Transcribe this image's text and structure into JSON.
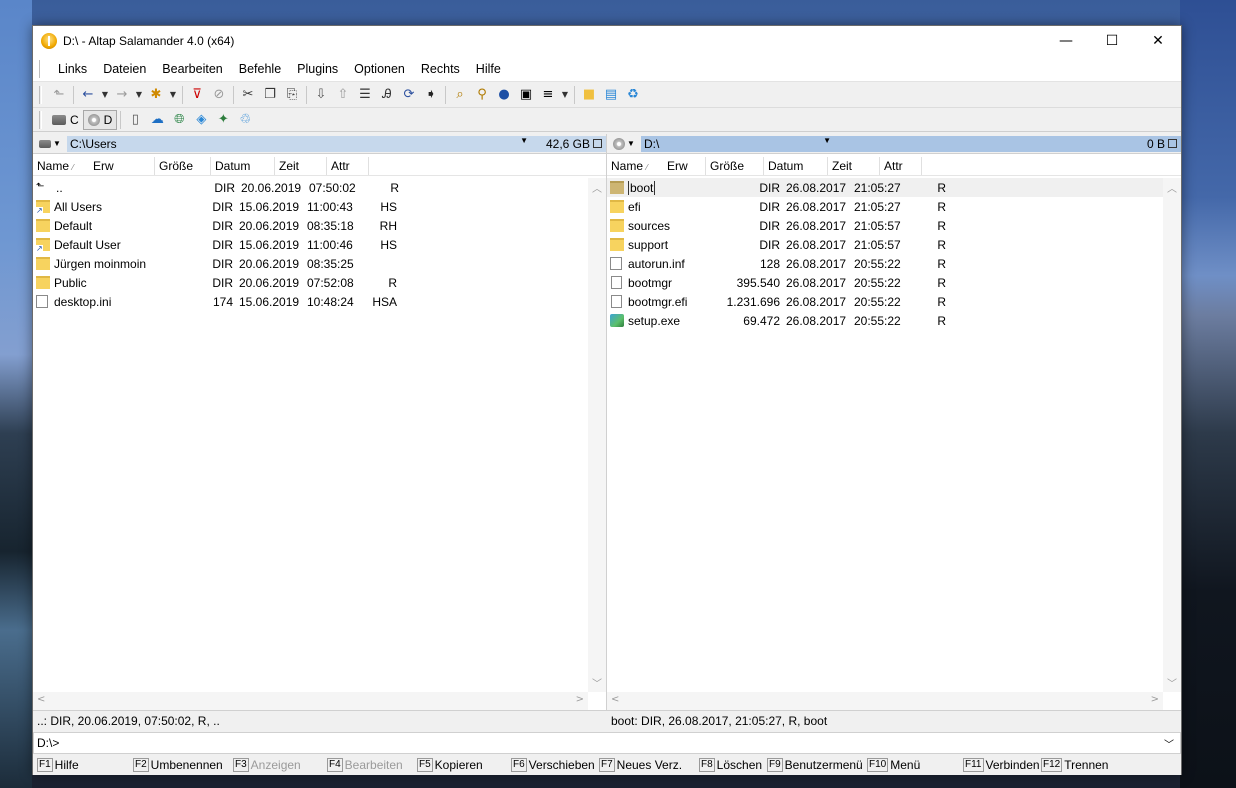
{
  "window": {
    "title": "D:\\ - Altap Salamander 4.0 (x64)"
  },
  "titlebar_buttons": {
    "minimize": "—",
    "maximize": "☐",
    "close": "✕"
  },
  "menu": [
    "Links",
    "Dateien",
    "Bearbeiten",
    "Befehle",
    "Plugins",
    "Optionen",
    "Rechts",
    "Hilfe"
  ],
  "drives": {
    "c": "C",
    "d": "D"
  },
  "left_panel": {
    "path": "C:\\Users",
    "free_space": "42,6 GB",
    "columns": [
      "Name",
      "Erw",
      "Größe",
      "Datum",
      "Zeit",
      "Attr"
    ],
    "rows": [
      {
        "name": "..",
        "size": "DIR",
        "date": "20.06.2019",
        "time": "07:50:02",
        "attr": "R",
        "icon": "up-dir-icon"
      },
      {
        "name": "All Users",
        "size": "DIR",
        "date": "15.06.2019",
        "time": "11:00:43",
        "attr": "HS",
        "icon": "folder-link-icon"
      },
      {
        "name": "Default",
        "size": "DIR",
        "date": "20.06.2019",
        "time": "08:35:18",
        "attr": "RH",
        "icon": "folder-icon"
      },
      {
        "name": "Default User",
        "size": "DIR",
        "date": "15.06.2019",
        "time": "11:00:46",
        "attr": "HS",
        "icon": "folder-link-icon"
      },
      {
        "name": "Jürgen moinmoin",
        "size": "DIR",
        "date": "20.06.2019",
        "time": "08:35:25",
        "attr": "",
        "icon": "folder-icon"
      },
      {
        "name": "Public",
        "size": "DIR",
        "date": "20.06.2019",
        "time": "07:52:08",
        "attr": "R",
        "icon": "folder-icon"
      },
      {
        "name": "desktop.ini",
        "size": "174",
        "date": "15.06.2019",
        "time": "10:48:24",
        "attr": "HSA",
        "icon": "settings-file-icon"
      }
    ],
    "status": "..: DIR, 20.06.2019, 07:50:02, R, .."
  },
  "right_panel": {
    "path": "D:\\",
    "free_space": "0 B",
    "columns": [
      "Name",
      "Erw",
      "Größe",
      "Datum",
      "Zeit",
      "Attr"
    ],
    "rows": [
      {
        "name": "boot",
        "size": "DIR",
        "date": "26.08.2017",
        "time": "21:05:27",
        "attr": "R",
        "icon": "folder-icon"
      },
      {
        "name": "efi",
        "size": "DIR",
        "date": "26.08.2017",
        "time": "21:05:27",
        "attr": "R",
        "icon": "folder-icon"
      },
      {
        "name": "sources",
        "size": "DIR",
        "date": "26.08.2017",
        "time": "21:05:57",
        "attr": "R",
        "icon": "folder-icon"
      },
      {
        "name": "support",
        "size": "DIR",
        "date": "26.08.2017",
        "time": "21:05:57",
        "attr": "R",
        "icon": "folder-icon"
      },
      {
        "name": "autorun.inf",
        "size": "128",
        "date": "26.08.2017",
        "time": "20:55:22",
        "attr": "R",
        "icon": "settings-file-icon"
      },
      {
        "name": "bootmgr",
        "size": "395.540",
        "date": "26.08.2017",
        "time": "20:55:22",
        "attr": "R",
        "icon": "file-icon"
      },
      {
        "name": "bootmgr.efi",
        "size": "1.231.696",
        "date": "26.08.2017",
        "time": "20:55:22",
        "attr": "R",
        "icon": "file-icon"
      },
      {
        "name": "setup.exe",
        "size": "69.472",
        "date": "26.08.2017",
        "time": "20:55:22",
        "attr": "R",
        "icon": "exe-icon"
      }
    ],
    "status": "boot: DIR, 26.08.2017, 21:05:27, R, boot"
  },
  "command_line": "D:\\>",
  "fkeys": [
    {
      "key": "F1",
      "label": "Hilfe",
      "enabled": true
    },
    {
      "key": "F2",
      "label": "Umbenennen",
      "enabled": true
    },
    {
      "key": "F3",
      "label": "Anzeigen",
      "enabled": false
    },
    {
      "key": "F4",
      "label": "Bearbeiten",
      "enabled": false
    },
    {
      "key": "F5",
      "label": "Kopieren",
      "enabled": true
    },
    {
      "key": "F6",
      "label": "Verschieben",
      "enabled": true
    },
    {
      "key": "F7",
      "label": "Neues Verz.",
      "enabled": true
    },
    {
      "key": "F8",
      "label": "Löschen",
      "enabled": true
    },
    {
      "key": "F9",
      "label": "Benutzermenü",
      "enabled": true
    },
    {
      "key": "F10",
      "label": "Menü",
      "enabled": true
    },
    {
      "key": "F11",
      "label": "Verbinden",
      "enabled": true
    },
    {
      "key": "F12",
      "label": "Trennen",
      "enabled": true
    }
  ]
}
